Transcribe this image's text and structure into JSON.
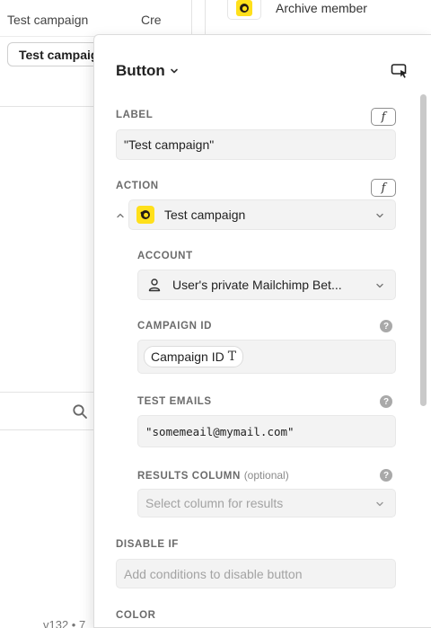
{
  "background": {
    "table_name_cell": "Test campaign",
    "table_created_cell": "Cre",
    "selected_pill": "Test campaign",
    "archive_label": "Archive member",
    "version_text": "v132 • 7"
  },
  "panel": {
    "title": "Button",
    "label_section": {
      "label": "LABEL",
      "fx": "f",
      "value": "\"Test campaign\""
    },
    "action_section": {
      "label": "ACTION",
      "fx": "f",
      "value": "Test campaign",
      "icon": "mailchimp-icon"
    },
    "account_section": {
      "label": "ACCOUNT",
      "value": "User's private Mailchimp Bet...",
      "icon": "user-icon"
    },
    "campaign_id_section": {
      "label": "CAMPAIGN ID",
      "chip": "Campaign ID",
      "chip_icon": "T"
    },
    "test_emails_section": {
      "label": "TEST EMAILS",
      "value": "\"somemeail@mymail.com\""
    },
    "results_column_section": {
      "label": "RESULTS COLUMN",
      "optional": "(optional)",
      "placeholder": "Select column for results"
    },
    "disable_if_section": {
      "label": "DISABLE IF",
      "placeholder": "Add conditions to disable button"
    },
    "color_section": {
      "label": "COLOR"
    }
  },
  "colors": {
    "mailchimp_yellow": "#ffe01b",
    "field_bg": "#f3f3f3",
    "label_gray": "#6b6b6b"
  }
}
